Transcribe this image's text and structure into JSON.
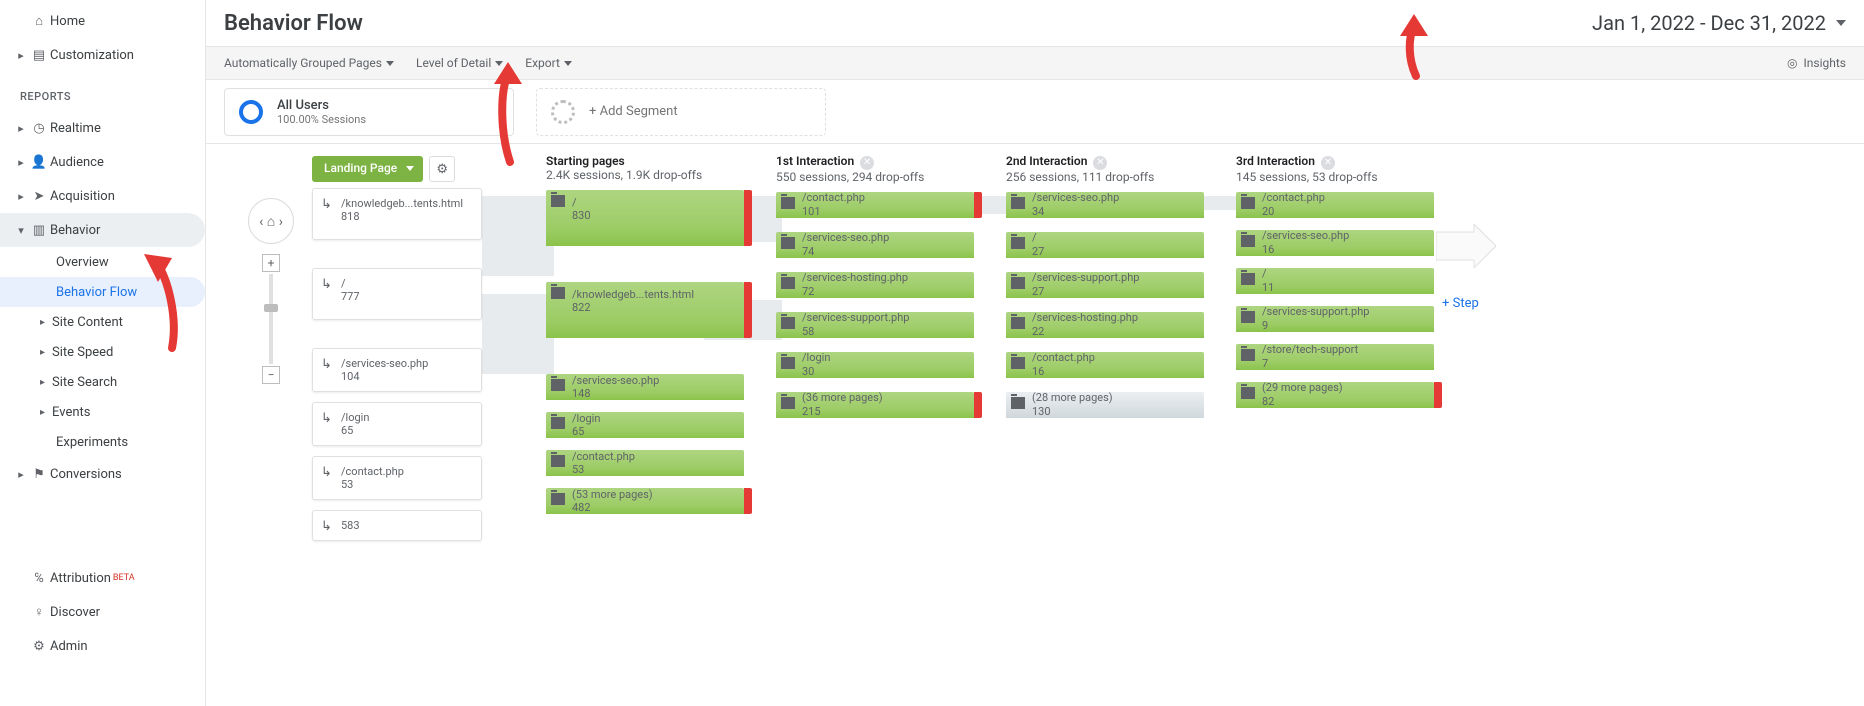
{
  "sidebar": {
    "home": "Home",
    "customization": "Customization",
    "section_reports": "REPORTS",
    "realtime": "Realtime",
    "audience": "Audience",
    "acquisition": "Acquisition",
    "behavior": "Behavior",
    "behavior_sub": {
      "overview": "Overview",
      "behavior_flow": "Behavior Flow",
      "site_content": "Site Content",
      "site_speed": "Site Speed",
      "site_search": "Site Search",
      "events": "Events",
      "experiments": "Experiments"
    },
    "conversions": "Conversions",
    "attribution": "Attribution",
    "attribution_beta": "BETA",
    "discover": "Discover",
    "admin": "Admin"
  },
  "header": {
    "title": "Behavior Flow",
    "date_range": "Jan 1, 2022 - Dec 31, 2022"
  },
  "toolbar": {
    "auto_grouped": "Automatically Grouped Pages",
    "detail": "Level of Detail",
    "export": "Export",
    "insights": "Insights"
  },
  "segments": {
    "all_users": "All Users",
    "all_users_sub": "100.00% Sessions",
    "add": "+ Add Segment"
  },
  "flow": {
    "dimension": "Landing Page",
    "src0_path": "/knowledgeb...tents.html",
    "src0_count": "818",
    "src1_path": "/",
    "src1_count": "777",
    "src2_path": "/services-seo.php",
    "src2_count": "104",
    "src3_path": "/login",
    "src3_count": "65",
    "src4_path": "/contact.php",
    "src4_count": "53",
    "src5_path": "",
    "src5_count": "583",
    "col_sp_title": "Starting pages",
    "col_sp_sub": "2.4K sessions, 1.9K drop-offs",
    "col_i1_title": "1st Interaction",
    "col_i1_sub": "550 sessions, 294 drop-offs",
    "col_i2_title": "2nd Interaction",
    "col_i2_sub": "256 sessions, 111 drop-offs",
    "col_i3_title": "3rd Interaction",
    "col_i3_sub": "145 sessions, 53 drop-offs",
    "sp0_path": "/",
    "sp0_count": "830",
    "sp1_path": "/knowledgeb...tents.html",
    "sp1_count": "822",
    "sp2_path": "/services-seo.php",
    "sp2_count": "148",
    "sp3_path": "/login",
    "sp3_count": "65",
    "sp4_path": "/contact.php",
    "sp4_count": "53",
    "sp5_path": "(53 more pages)",
    "sp5_count": "482",
    "i1_0_path": "/contact.php",
    "i1_0_count": "101",
    "i1_1_path": "/services-seo.php",
    "i1_1_count": "74",
    "i1_2_path": "/services-hosting.php",
    "i1_2_count": "72",
    "i1_3_path": "/services-support.php",
    "i1_3_count": "58",
    "i1_4_path": "/login",
    "i1_4_count": "30",
    "i1_5_path": "(36 more pages)",
    "i1_5_count": "215",
    "i2_0_path": "/services-seo.php",
    "i2_0_count": "34",
    "i2_1_path": "/",
    "i2_1_count": "27",
    "i2_2_path": "/services-support.php",
    "i2_2_count": "27",
    "i2_3_path": "/services-hosting.php",
    "i2_3_count": "22",
    "i2_4_path": "/contact.php",
    "i2_4_count": "16",
    "i2_5_path": "(28 more pages)",
    "i2_5_count": "130",
    "i3_0_path": "/contact.php",
    "i3_0_count": "20",
    "i3_1_path": "/services-seo.php",
    "i3_1_count": "16",
    "i3_2_path": "/",
    "i3_2_count": "11",
    "i3_3_path": "/services-support.php",
    "i3_3_count": "9",
    "i3_4_path": "/store/tech-support",
    "i3_4_count": "7",
    "i3_5_path": "(29 more pages)",
    "i3_5_count": "82",
    "add_step": "+ Step"
  }
}
